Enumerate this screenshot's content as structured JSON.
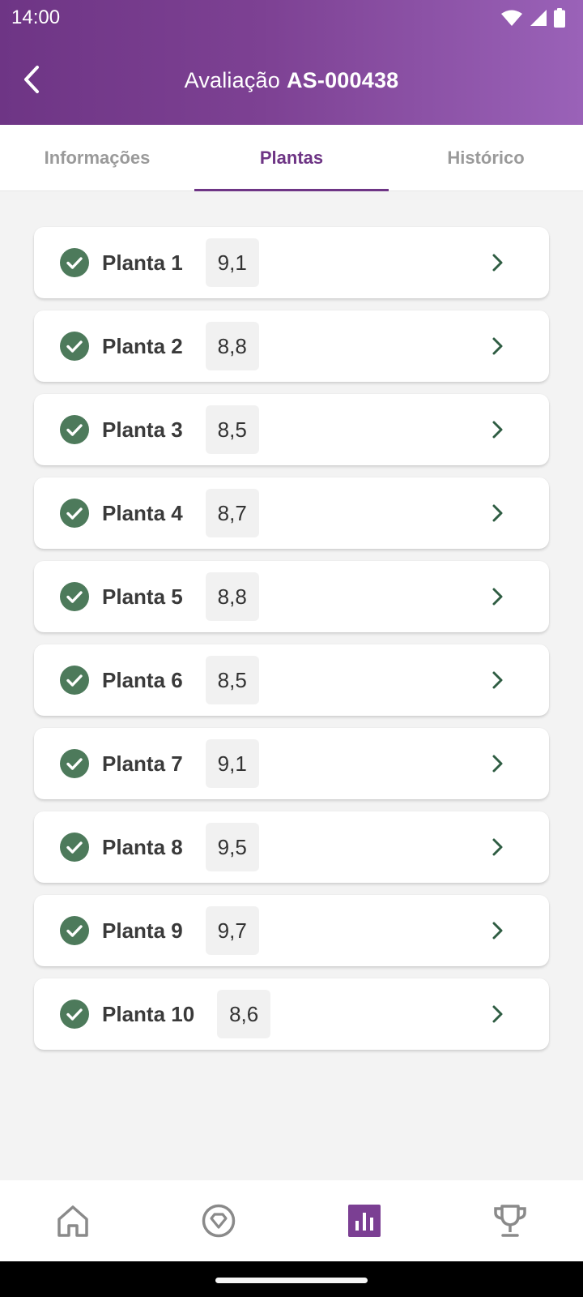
{
  "status_bar": {
    "time": "14:00"
  },
  "header": {
    "title_prefix": "Avaliação",
    "title_code": "AS-000438"
  },
  "tabs": [
    {
      "label": "Informações",
      "active": false
    },
    {
      "label": "Plantas",
      "active": true
    },
    {
      "label": "Histórico",
      "active": false
    }
  ],
  "plants": [
    {
      "name": "Planta 1",
      "score": "9,1"
    },
    {
      "name": "Planta 2",
      "score": "8,8"
    },
    {
      "name": "Planta 3",
      "score": "8,5"
    },
    {
      "name": "Planta 4",
      "score": "8,7"
    },
    {
      "name": "Planta 5",
      "score": "8,8"
    },
    {
      "name": "Planta 6",
      "score": "8,5"
    },
    {
      "name": "Planta 7",
      "score": "9,1"
    },
    {
      "name": "Planta 8",
      "score": "9,5"
    },
    {
      "name": "Planta 9",
      "score": "9,7"
    },
    {
      "name": "Planta 10",
      "score": "8,6"
    }
  ],
  "bottom_nav": [
    {
      "icon": "home-icon",
      "active": false
    },
    {
      "icon": "diamond-badge-icon",
      "active": false
    },
    {
      "icon": "bar-chart-icon",
      "active": true
    },
    {
      "icon": "trophy-icon",
      "active": false
    }
  ],
  "colors": {
    "primary": "#6e3585",
    "check_green": "#4d7a5b",
    "chevron": "#2f5d43",
    "inactive_icon": "#8a8a8a"
  }
}
